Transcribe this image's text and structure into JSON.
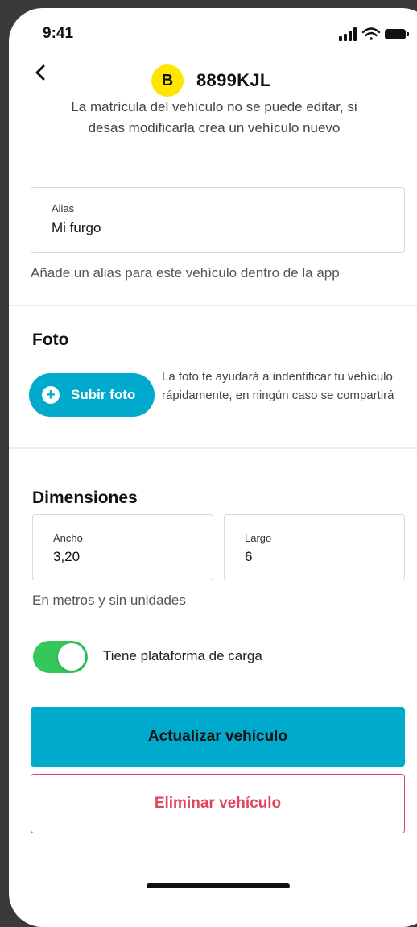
{
  "status_bar": {
    "time": "9:41",
    "icons": [
      "signal-icon",
      "wifi-icon",
      "battery-icon"
    ]
  },
  "header": {
    "back_icon": "chevron-left-icon",
    "plate_letter": "B",
    "plate_number": "8899KJL",
    "plate_note": "La matrícula del vehículo no se puede editar, si desas modificarla crea un vehículo nuevo"
  },
  "alias": {
    "label": "Alias",
    "value": "Mi furgo",
    "helper": "Añade un alias para este vehículo dentro de la app"
  },
  "photo": {
    "title": "Foto",
    "upload_label": "Subir foto",
    "note": "La foto te ayudará a indentificar tu vehículo rápidamente, en ningún caso se compartirá"
  },
  "dimensions": {
    "title": "Dimensiones",
    "width_label": "Ancho",
    "width_value": "3,20",
    "length_label": "Largo",
    "length_value": "6",
    "helper": "En metros y sin unidades"
  },
  "cargo_platform": {
    "label": "Tiene plataforma de carga",
    "enabled": true
  },
  "actions": {
    "update_label": "Actualizar vehículo",
    "delete_label": "Eliminar vehículo"
  },
  "colors": {
    "accent": "#00AACC",
    "plate_badge": "#FFE600",
    "toggle_on": "#34C759",
    "danger": "#E0455E"
  }
}
